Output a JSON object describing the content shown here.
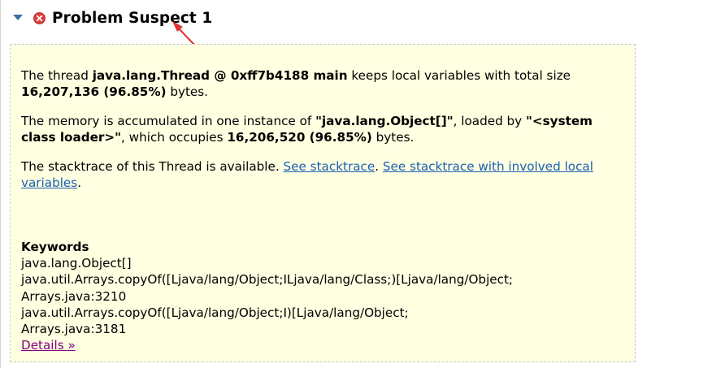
{
  "header": {
    "title": "Problem Suspect 1",
    "toggle_icon": "triangle-down-icon",
    "status_icon": "error-circle-icon"
  },
  "colors": {
    "toggle": "#3a6ea5",
    "error_icon": "#e04040",
    "box_background": "#ffffe1",
    "link": "#1a5fb4",
    "visited_link": "#800080",
    "annotation_arrow": "#e03030"
  },
  "suspect": {
    "p1": {
      "t1": "The thread ",
      "b1": "java.lang.Thread @ 0xff7b4188 main",
      "t2": " keeps local variables with total size ",
      "b2": "16,207,136 (96.85%)",
      "t3": " bytes."
    },
    "p2": {
      "t1": "The memory is accumulated in one instance of ",
      "b1": "\"java.lang.Object[]\"",
      "t2": ", loaded by ",
      "b2": "\"<system class loader>\"",
      "t3": ", which occupies ",
      "b3": "16,206,520 (96.85%)",
      "t4": " bytes."
    },
    "p3": {
      "t1": "The stacktrace of this Thread is available. ",
      "link1": "See stacktrace",
      "t2": ". ",
      "link2": "See stacktrace with involved local variables",
      "t3": "."
    }
  },
  "keywords": {
    "heading": "Keywords",
    "items": [
      "java.lang.Object[]",
      "java.util.Arrays.copyOf([Ljava/lang/Object;ILjava/lang/Class;)[Ljava/lang/Object;",
      "Arrays.java:3210",
      "java.util.Arrays.copyOf([Ljava/lang/Object;I)[Ljava/lang/Object;",
      "Arrays.java:3181"
    ],
    "details_link": "Details »"
  }
}
